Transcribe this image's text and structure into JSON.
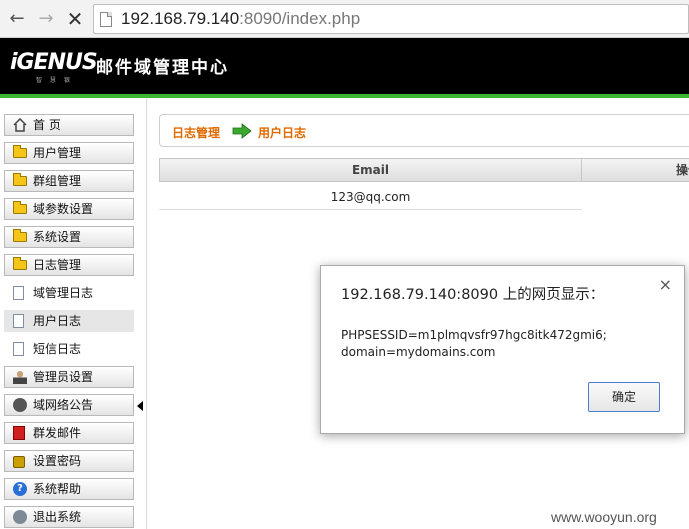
{
  "browser": {
    "url_host": "192.168.79.140",
    "url_rest": ":8090/index.php"
  },
  "header": {
    "logo_text": "iGENUS",
    "logo_sub": "智 慧 银",
    "title": "邮件域管理中心"
  },
  "sidebar": {
    "items": [
      {
        "label": "首 页",
        "icon": "home-icon"
      },
      {
        "label": "用户管理",
        "icon": "folder-icon"
      },
      {
        "label": "群组管理",
        "icon": "folder-icon"
      },
      {
        "label": "域参数设置",
        "icon": "folder-icon"
      },
      {
        "label": "系统设置",
        "icon": "folder-icon"
      },
      {
        "label": "日志管理",
        "icon": "folder-icon"
      },
      {
        "label": "域管理日志",
        "icon": "document-icon"
      },
      {
        "label": "用户日志",
        "icon": "document-icon"
      },
      {
        "label": "短信日志",
        "icon": "document-icon"
      },
      {
        "label": "管理员设置",
        "icon": "user-icon"
      },
      {
        "label": "域网络公告",
        "icon": "network-icon"
      },
      {
        "label": "群发邮件",
        "icon": "mail-icon"
      },
      {
        "label": "设置密码",
        "icon": "lock-icon"
      },
      {
        "label": "系统帮助",
        "icon": "help-icon"
      },
      {
        "label": "退出系统",
        "icon": "exit-icon"
      }
    ]
  },
  "breadcrumb": {
    "parent": "日志管理",
    "current": "用户日志"
  },
  "table": {
    "headers": [
      "Email",
      "操作"
    ],
    "rows": [
      [
        "123@qq.com",
        ""
      ]
    ]
  },
  "dialog": {
    "title": "192.168.79.140:8090 上的网页显示：",
    "message_line1": "PHPSESSID=m1plmqvsfr97hgc8itk472gmi6;",
    "message_line2": "domain=mydomains.com",
    "ok_label": "确定",
    "close_glyph": "×"
  },
  "watermark": "www.wooyun.org",
  "colors": {
    "accent_orange": "#e06a00",
    "banner_green": "#3db631"
  }
}
